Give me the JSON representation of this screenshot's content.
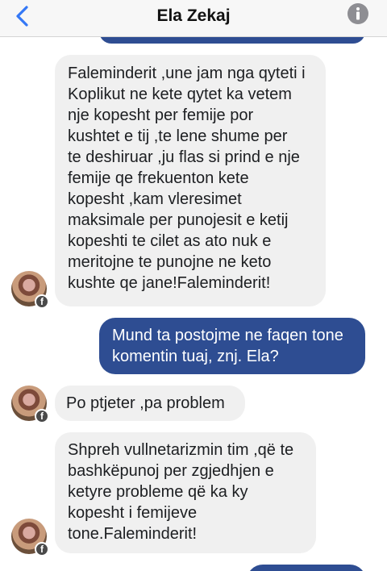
{
  "header": {
    "title": "Ela Zekaj"
  },
  "messages": [
    {
      "side": "in",
      "text": "Faleminderit ,une jam nga qyteti i\nKoplikut ne kete qytet ka vetem\nnje kopesht per femije por\nkushtet e tij ,te lene shume per\nte deshiruar ,ju flas si prind e nje\nfemije qe frekuenton kete\nkopesht ,kam vleresimet\nmaksimale per punojesit e ketij\nkopeshti te cilet as ato nuk e\nmeritojne te punojne ne keto\nkushte qe jane!Faleminderit!"
    },
    {
      "side": "out",
      "text": "Mund ta postojme ne faqen tone\nkomentin tuaj, znj. Ela?"
    },
    {
      "side": "in",
      "text": "Po ptjeter ,pa problem"
    },
    {
      "side": "in",
      "text": "Shpreh vullnetarizmin tim ,që te\nbashkëpunoj per zgjedhjen e\nketyre probleme që ka ky\nkopesht i femijeve\ntone.Faleminderit!"
    }
  ],
  "icons": {
    "back": "chevron-left-icon",
    "info": "info-icon",
    "badge": "facebook-badge-icon"
  },
  "colors": {
    "outgoing_bubble": "#2e4d92",
    "incoming_bubble": "#f0f0f0",
    "accent": "#3478f6"
  }
}
